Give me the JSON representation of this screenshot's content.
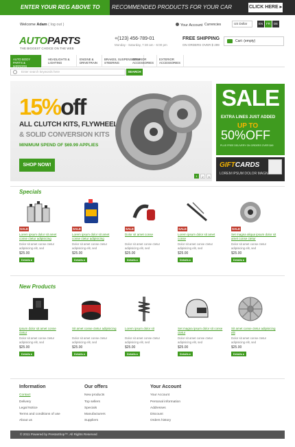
{
  "promo": {
    "headline": "ENTER YOUR REG ABOVE TO SEE",
    "subline": "RECOMMENDED PRODUCTS FOR YOUR CAR",
    "button": "CLICK HERE ▸"
  },
  "header": {
    "welcome_prefix": "Welcome",
    "user_name": "Adam",
    "logout": "( log out )",
    "account": "Your Account",
    "currencies_label": "Currencies",
    "currency_value": "US Dollar",
    "languages": [
      "EN",
      "FR",
      "DE"
    ],
    "logo_part1": "AUTO",
    "logo_part2": "PARTS",
    "tagline": "THE BIGGEST CHOICE ON THE WEB",
    "phone": "+(123) 456-789-01",
    "hours": "Monday - Saturday, 7:30 am - 6:00 pm",
    "shipping_title": "FREE SHIPPING",
    "shipping_sub": "ON ORDERS OVER $ 299",
    "cart_label": "Cart: (empty)"
  },
  "nav": {
    "items": [
      "AUTO BODY PARTS & MIRRORS",
      "HEADLIGHTS & LIGHTING",
      "ENGINE & DRIVETRAIN",
      "BRAKES, SUSPENSION & STEERING",
      "INTERIOR ACCESSORIES",
      "EXTERIOR ACCESSORIES"
    ]
  },
  "search": {
    "placeholder": "Enter search keywords here",
    "button": "SEARCH"
  },
  "banner": {
    "percent": "15%",
    "off": "off",
    "line1": "ALL CLUTCH KITS, FLYWHEELS",
    "line2": "& SOLID CONVERSION KITS",
    "min_spend": "MINIMUM SPEND OF $69.99 APPLIES",
    "button": "SHOP NOW!",
    "pages": [
      "1",
      "2",
      "3"
    ]
  },
  "sale_panel": {
    "title": "SALE",
    "extra": "EXTRA LINES JUST ADDED",
    "up_to": "UP TO",
    "percent": "50%OFF",
    "note": "PLUS FREE DELIVERY ON ORDERS OVER $49"
  },
  "gift_panel": {
    "gift": "GIFT",
    "cards": "CARDS",
    "sub": "LOREM IPSUM DOLOR MAGNA"
  },
  "specials": {
    "title": "Specials",
    "items": [
      {
        "icon": "oil-bottles-icon",
        "badge": "SALE",
        "name": "Lorem ipsum dolor sit amet conse ctetur adipisicing",
        "desc": "Dolor sit amet conse ctetur adipisicing elit, sed",
        "price": "$25.00",
        "button": "Details ▸"
      },
      {
        "icon": "motor-oil-icon",
        "badge": "SALE",
        "name": "Lorem ipsum dolor sit amet conse ctetur adipisicing",
        "desc": "Dolor sit amet conse ctetur adipisicing elit, sed",
        "price": "$25.00",
        "button": "Details ▸"
      },
      {
        "icon": "air-intake-icon",
        "badge": "SALE",
        "name": "Dolor sit amet conse",
        "desc": "Dolor sit amet conse ctetur adipisicing elit, sed",
        "price": "$25.00",
        "button": "Details ▸"
      },
      {
        "icon": "wiper-blade-icon",
        "badge": "SALE",
        "name": "Lorem ipsum dolor sit amet conse",
        "desc": "Dolor sit amet conse ctetur adipisicing elit, sed",
        "price": "$25.00",
        "button": "Details ▸"
      },
      {
        "icon": "wheel-hub-icon",
        "badge": "SALE",
        "name": "Set magna aliqua ipsum dolor sit amet conse ctetur",
        "desc": "Dolor sit amet conse ctetur adipisicing elit, sed",
        "price": "$25.00",
        "button": "Details ▸"
      }
    ]
  },
  "new_products": {
    "title": "New Products",
    "items": [
      {
        "icon": "racing-seat-icon",
        "name": "Ipsum dolor sit amet conse ctetur",
        "desc": "Dolor sit amet conse ctetur adipisicing elit, sed",
        "price": "$25.00",
        "button": "Details ▸"
      },
      {
        "icon": "air-filter-icon",
        "name": "Sit amet conse ctetur adipisicing",
        "desc": "Dolor sit amet conse ctetur adipisicing elit, sed",
        "price": "$25.00",
        "button": "Details ▸"
      },
      {
        "icon": "shock-absorber-icon",
        "name": "Lorem ipsum dolor sit",
        "desc": "Dolor sit amet conse ctetur adipisicing elit, sed",
        "price": "$25.00",
        "button": "Details ▸"
      },
      {
        "icon": "helmet-icon",
        "name": "Set magna ipsum dolor sit conse ctetur",
        "desc": "Dolor sit amet conse ctetur adipisicing elit, sed",
        "price": "$25.00",
        "button": "Details ▸"
      },
      {
        "icon": "rim-icon",
        "name": "Sit amet conse ctetur adipisicing elit",
        "desc": "Dolor sit amet conse ctetur adipisicing elit, sed",
        "price": "$25.00",
        "button": "Details ▸"
      }
    ]
  },
  "footer": {
    "information": {
      "title": "Information",
      "links": [
        "Contact",
        "Delivery",
        "Legal Notice",
        "Terms and conditions of use",
        "About us"
      ]
    },
    "offers": {
      "title": "Our offers",
      "links": [
        "New products",
        "Top sellers",
        "Specials",
        "Manufacturers",
        "Suppliers"
      ]
    },
    "account": {
      "title": "Your Account",
      "links": [
        "Your Account",
        "Personal information",
        "Addresses",
        "Discount",
        "Orders history"
      ]
    },
    "copyright": "© 2011 Powered by PrestaShop™. All Rights Reserved"
  },
  "colors": {
    "brand_green": "#3f9b1f",
    "accent_yellow": "#f7b500",
    "sale_red": "#c0392b",
    "dark": "#2b2b2b"
  }
}
